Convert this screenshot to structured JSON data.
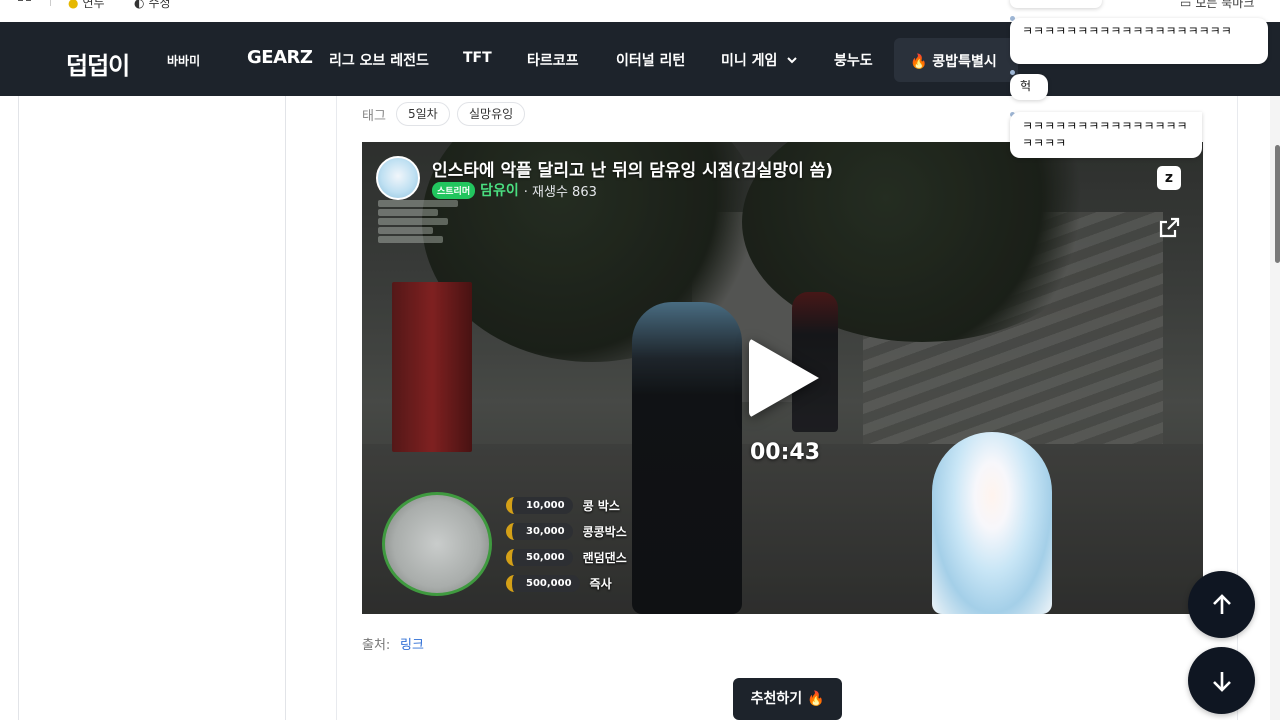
{
  "bookmarks": {
    "items": [
      "연두",
      "수정"
    ],
    "right": "모든 북마크"
  },
  "nav": {
    "logo": "덥덥이",
    "items": [
      "바바미",
      "GEARZ",
      "리그 오브 레전드",
      "TFT",
      "타르코프",
      "이터널 리턴",
      "미니 게임",
      "붕누도"
    ],
    "hot": "🔥 콩밥특별시"
  },
  "tags": {
    "label": "태그",
    "chips": [
      "5일차",
      "실망유잉"
    ]
  },
  "video": {
    "title": "인스타에 악플 달리고 난 뒤의 담유잉 시점(김실망이 씀)",
    "badge": "스트리머",
    "streamer": "담유이",
    "views": "· 재생수 863",
    "brand_glyph": "z",
    "duration": "00:43",
    "donations": [
      {
        "amount": "10,000",
        "name": "콩 박스"
      },
      {
        "amount": "30,000",
        "name": "콩콩박스"
      },
      {
        "amount": "50,000",
        "name": "랜덤댄스"
      },
      {
        "amount": "500,000",
        "name": "즉사"
      }
    ]
  },
  "source": {
    "label": "출처:",
    "link": "링크"
  },
  "recommend": {
    "label": "추천하기 🔥"
  },
  "chat": {
    "messages": [
      "ㅋㅋㅋㅋㅋㅋㅋㅋㅋㅋㅋㅋㅋㅋㅋㅋㅋㅋㅋ",
      "헉",
      "ㅋㅋㅋㅋㅋㅋㅋㅋㅋㅋㅋㅋㅋㅋㅋㅋㅋㅋㅋ"
    ]
  },
  "colors": {
    "nav_bg": "#1d232b",
    "accent_green": "#22c55e",
    "link_blue": "#2f6fd6",
    "fab_bg": "#0f1622"
  },
  "icons": {
    "apps": "grid-icon",
    "up": "arrow-up-icon",
    "down": "arrow-down-icon",
    "external": "external-link-icon",
    "play": "play-icon",
    "chevron": "chevron-down-icon"
  }
}
